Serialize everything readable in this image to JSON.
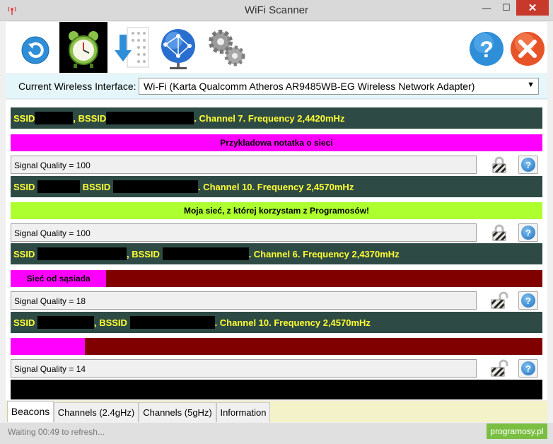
{
  "window": {
    "title": "WiFi Scanner",
    "min": "—",
    "max": "☐",
    "close": "✕"
  },
  "toolbar": {
    "icons": [
      "refresh-icon",
      "alarm-clock-icon",
      "download-icon",
      "network-globe-icon",
      "settings-gears-icon",
      "help-icon",
      "close-icon"
    ]
  },
  "interface": {
    "label": "Current Wireless Interface:",
    "selected": "Wi-Fi (Karta Qualcomm Atheros AR9485WB-EG Wireless Network Adapter)",
    "arrow": "▼"
  },
  "networks": [
    {
      "ssid": "SSID",
      "bssid": "BSSID",
      "tail": ". Channel 7. Frequency 2,4420mHz",
      "note": "Przykładowa notatka o sieci",
      "note_color": "#ff00ff",
      "note_fill": 1.0,
      "signal": "Signal Quality = 100",
      "secured": true
    },
    {
      "ssid": "SSID",
      "bssid": "BSSID",
      "tail": ". Channel 10. Frequency 2,4570mHz",
      "note": "Moja sieć, z której korzystam z Programosów!",
      "note_color": "#adff2f",
      "note_fill": 1.0,
      "signal": "Signal Quality = 100",
      "secured": true
    },
    {
      "ssid": "SSID",
      "bssid": "BSSID",
      "tail": ". Channel 6. Frequency 2,4370mHz",
      "note": "Sieć od sąsiada",
      "note_color": "#ff00ff",
      "note_fill": 0.18,
      "signal": "Signal Quality = 18",
      "secured": false
    },
    {
      "ssid": "SSID",
      "bssid": "BSSID",
      "tail": ". Channel 10. Frequency 2,4570mHz",
      "note": "",
      "note_color": "#ff00ff",
      "note_fill": 0.14,
      "signal": "Signal Quality = 14",
      "secured": false
    }
  ],
  "tabs": [
    "Beacons",
    "Channels (2.4gHz)",
    "Channels (5gHz)",
    "Information"
  ],
  "status": {
    "text": "Waiting 00:49 to refresh...",
    "brand": "programosy.pl"
  },
  "colors": {
    "ssid_bar": "#2e4a44",
    "ssid_text": "#ffff33",
    "weak_bar": "#800000"
  }
}
